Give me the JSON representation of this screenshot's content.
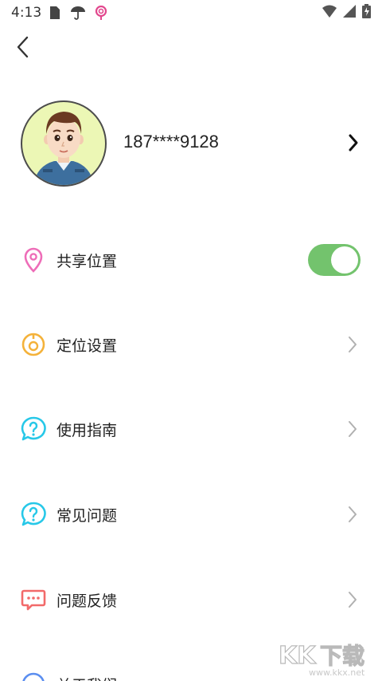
{
  "status_bar": {
    "time": "4:13",
    "left_icons": [
      "sim-card-icon",
      "umbrella-icon",
      "lollipop-icon"
    ],
    "right_icons": [
      "wifi-icon",
      "cell-signal-icon",
      "battery-charging-icon"
    ]
  },
  "header": {
    "back_icon": "chevron-left-icon"
  },
  "profile": {
    "avatar_icon": "cartoon-avatar",
    "phone": "187****9128"
  },
  "menu": [
    {
      "label": "共享位置",
      "icon": "location-pin-icon",
      "color": "#ee6db8",
      "control": "toggle",
      "toggle_on": true
    },
    {
      "label": "定位设置",
      "icon": "location-target-icon",
      "color": "#f4b23a",
      "control": "chevron"
    },
    {
      "label": "使用指南",
      "icon": "question-bubble-icon",
      "color": "#27c8e8",
      "control": "chevron"
    },
    {
      "label": "常见问题",
      "icon": "question-bubble-icon",
      "color": "#27c8e8",
      "control": "chevron"
    },
    {
      "label": "问题反馈",
      "icon": "feedback-bubble-icon",
      "color": "#f26a6a",
      "control": "chevron"
    },
    {
      "label": "关于我们",
      "icon": "info-icon",
      "color": "#5b8ef0",
      "control": "chevron"
    }
  ],
  "colors": {
    "toggle_on": "#73c36d",
    "chevron": "#b0b0b0"
  },
  "watermark": {
    "text": "KK下载",
    "url_text": "www.kkx.net"
  }
}
